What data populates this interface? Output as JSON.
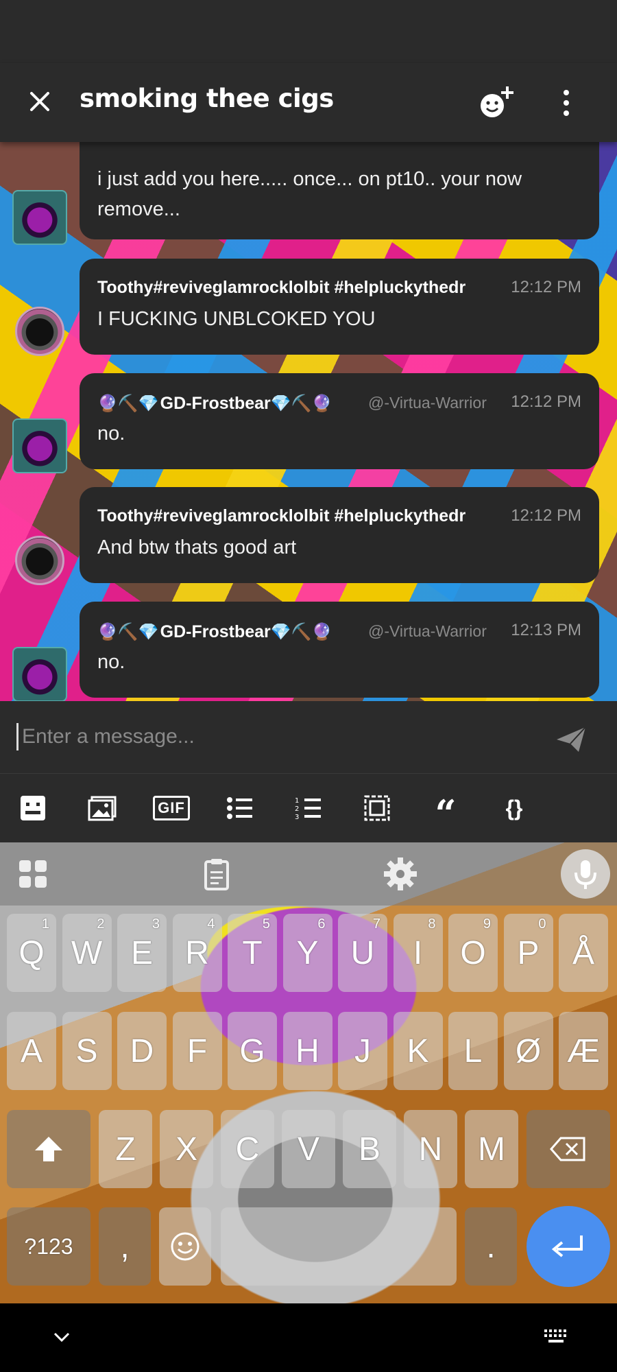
{
  "header": {
    "title": "smoking thee cigs",
    "close_icon": "close-icon",
    "add_member_icon": "add-member-icon",
    "more_icon": "more-vertical-icon"
  },
  "messages": [
    {
      "kind": "frost-continuation",
      "text_line1": "i just add you here..... once... on pt10.. your now",
      "text_line2": "remove..."
    },
    {
      "kind": "toothy",
      "author": "Toothy#reviveglamrocklolbit #helpluckythedr",
      "time": "12:12 PM",
      "text": "I FUCKING UNBLCOKED YOU"
    },
    {
      "kind": "frost",
      "author_prefix": "🔮⛏️💎",
      "author_name": "GD-Frostbear",
      "author_suffix": "💎⛏️🔮",
      "handle": "@-Virtua-Warrior",
      "time": "12:12 PM",
      "text": "no."
    },
    {
      "kind": "toothy",
      "author": "Toothy#reviveglamrocklolbit #helpluckythedr",
      "time": "12:12 PM",
      "text": "And btw thats good art"
    },
    {
      "kind": "frost",
      "author_prefix": "🔮⛏️💎",
      "author_name": "GD-Frostbear",
      "author_suffix": "💎⛏️🔮",
      "handle": "@-Virtua-Warrior",
      "time": "12:13 PM",
      "text": "no."
    }
  ],
  "composer": {
    "placeholder": "Enter a message...",
    "send_icon": "send-icon"
  },
  "toolbar": {
    "gif_label": "GIF",
    "quote_label": "“",
    "code_label": "{}"
  },
  "keyboard": {
    "row1": [
      {
        "key": "Q",
        "hint": "1"
      },
      {
        "key": "W",
        "hint": "2"
      },
      {
        "key": "E",
        "hint": "3"
      },
      {
        "key": "R",
        "hint": "4"
      },
      {
        "key": "T",
        "hint": "5"
      },
      {
        "key": "Y",
        "hint": "6"
      },
      {
        "key": "U",
        "hint": "7"
      },
      {
        "key": "I",
        "hint": "8"
      },
      {
        "key": "O",
        "hint": "9"
      },
      {
        "key": "P",
        "hint": "0"
      },
      {
        "key": "Å",
        "hint": ""
      }
    ],
    "row2": [
      "A",
      "S",
      "D",
      "F",
      "G",
      "H",
      "J",
      "K",
      "L",
      "Ø",
      "Æ"
    ],
    "row3": [
      "Z",
      "X",
      "C",
      "V",
      "B",
      "N",
      "M"
    ],
    "symbols_label": "?123",
    "comma_label": ",",
    "period_label": "."
  },
  "colors": {
    "bubble": "#282828",
    "header": "#2b2b2b",
    "enter_key": "#4a8ff0"
  }
}
